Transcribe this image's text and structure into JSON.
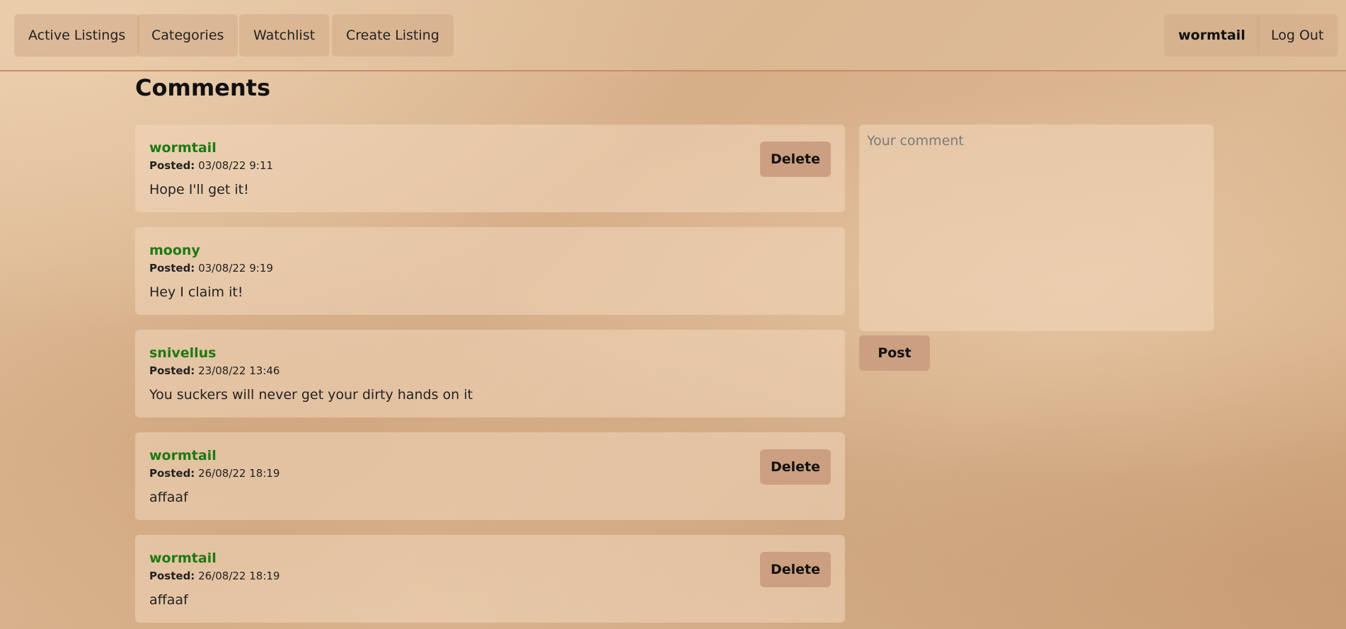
{
  "nav": {
    "left": [
      {
        "label": "Active Listings"
      },
      {
        "label": "Categories"
      },
      {
        "label": "Watchlist"
      },
      {
        "label": "Create Listing"
      }
    ],
    "username": "wormtail",
    "logout_label": "Log Out"
  },
  "comments_section": {
    "title": "Comments",
    "posted_label": "Posted:",
    "delete_label": "Delete",
    "items": [
      {
        "author": "wormtail",
        "posted": "03/08/22 9:11",
        "text": "Hope I'll get it!",
        "can_delete": true
      },
      {
        "author": "moony",
        "posted": "03/08/22 9:19",
        "text": "Hey I claim it!",
        "can_delete": false
      },
      {
        "author": "snivellus",
        "posted": "23/08/22 13:46",
        "text": "You suckers will never get your dirty hands on it",
        "can_delete": false
      },
      {
        "author": "wormtail",
        "posted": "26/08/22 18:19",
        "text": "affaaf",
        "can_delete": true
      },
      {
        "author": "wormtail",
        "posted": "26/08/22 18:19",
        "text": "affaaf",
        "can_delete": true
      }
    ]
  },
  "comment_form": {
    "placeholder": "Your comment",
    "value": "",
    "post_label": "Post"
  },
  "colors": {
    "author": "#1d7a12",
    "button_bg": "#cc9f80",
    "nav_border": "#c48f68"
  }
}
